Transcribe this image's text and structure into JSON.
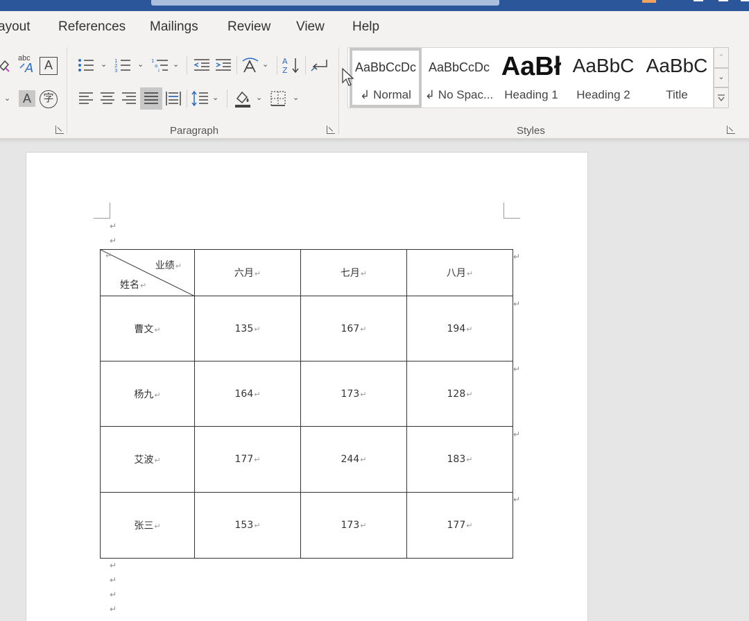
{
  "ribbon_tabs": [
    "ayout",
    "References",
    "Mailings",
    "Review",
    "View",
    "Help"
  ],
  "groups": {
    "paragraph_label": "Paragraph",
    "styles_label": "Styles"
  },
  "styles": [
    {
      "preview": "AaBbCcDc",
      "name": "↲ Normal"
    },
    {
      "preview": "AaBbCcDc",
      "name": "↲ No Spac..."
    },
    {
      "preview": "AaBł",
      "name": "Heading 1"
    },
    {
      "preview": "AaBbC",
      "name": "Heading 2"
    },
    {
      "preview": "AaBbC",
      "name": "Title"
    }
  ],
  "font_tools": {
    "abc_label": "abc",
    "box_a": "A",
    "shade_a": "A",
    "phonetic": "字"
  },
  "table": {
    "corner_top": "业绩",
    "corner_bottom": "姓名",
    "headers": [
      "六月",
      "七月",
      "八月"
    ],
    "rows": [
      {
        "name": "曹文",
        "values": [
          "135",
          "167",
          "194"
        ]
      },
      {
        "name": "杨九",
        "values": [
          "164",
          "173",
          "128"
        ]
      },
      {
        "name": "艾波",
        "values": [
          "177",
          "244",
          "183"
        ]
      },
      {
        "name": "张三",
        "values": [
          "153",
          "173",
          "177"
        ]
      }
    ]
  },
  "para_mark": "↵"
}
